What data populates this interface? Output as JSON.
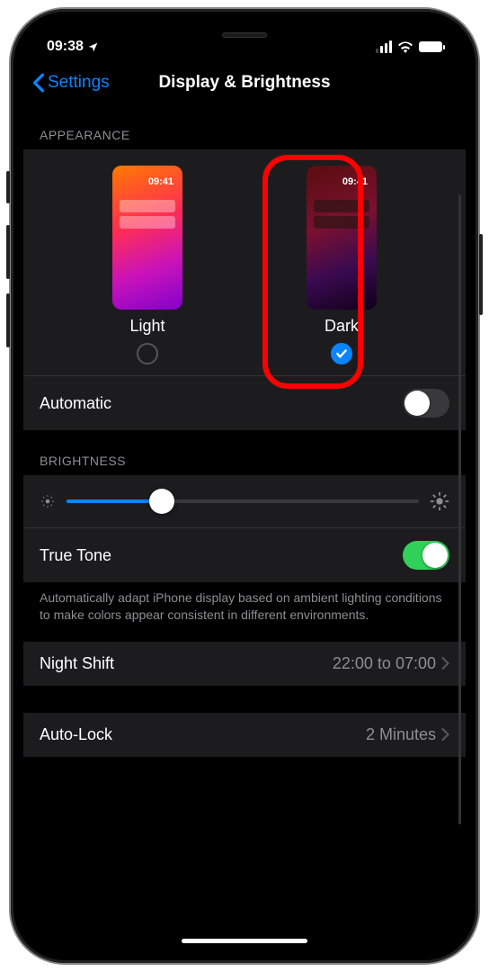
{
  "status": {
    "time": "09:38"
  },
  "nav": {
    "back": "Settings",
    "title": "Display & Brightness"
  },
  "appearance": {
    "header": "APPEARANCE",
    "preview_time": "09:41",
    "light_label": "Light",
    "dark_label": "Dark",
    "selected": "dark",
    "automatic_label": "Automatic",
    "automatic_on": false
  },
  "brightness": {
    "header": "BRIGHTNESS",
    "value_pct": 27,
    "truetone_label": "True Tone",
    "truetone_on": true,
    "truetone_desc": "Automatically adapt iPhone display based on ambient lighting conditions to make colors appear consistent in different environments."
  },
  "nightshift": {
    "label": "Night Shift",
    "value": "22:00 to 07:00"
  },
  "autolock": {
    "label": "Auto-Lock",
    "value": "2 Minutes"
  },
  "annotation": {
    "highlight": "dark-option"
  }
}
